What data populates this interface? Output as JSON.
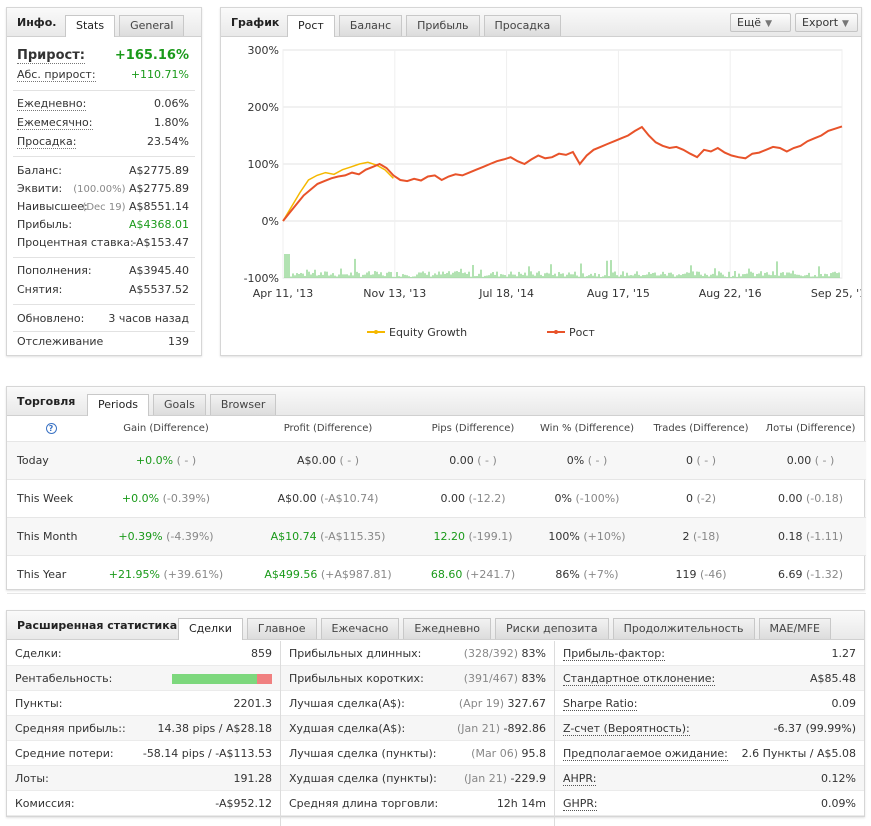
{
  "info_panel": {
    "title": "Инфо.",
    "tabs": [
      "Stats",
      "General"
    ],
    "gain": {
      "label": "Прирост:",
      "value": "+165.16%"
    },
    "abs_gain": {
      "label": "Абс. прирост:",
      "value": "+110.71%"
    },
    "daily": {
      "label": "Ежедневно:",
      "value": "0.06%"
    },
    "monthly": {
      "label": "Ежемесячно:",
      "value": "1.80%"
    },
    "drawdown": {
      "label": "Просадка:",
      "value": "23.54%"
    },
    "balance": {
      "label": "Баланс:",
      "value": "A$2775.89"
    },
    "equity": {
      "label": "Эквити:",
      "note": "(100.00%)",
      "value": "A$2775.89"
    },
    "highest": {
      "label": "Наивысшее:",
      "note": "(Dec 19)",
      "value": "A$8551.14"
    },
    "profit": {
      "label": "Прибыль:",
      "value": "A$4368.01"
    },
    "interest": {
      "label": "Процентная ставка:",
      "value": "-A$153.47"
    },
    "deposits": {
      "label": "Пополнения:",
      "value": "A$3945.40"
    },
    "withdrawals": {
      "label": "Снятия:",
      "value": "A$5537.52"
    },
    "updated": {
      "label": "Обновлено:",
      "value": "3 часов назад"
    },
    "tracking": {
      "label": "Отслеживание",
      "value": "139"
    }
  },
  "chart_panel": {
    "title": "График",
    "tabs": [
      "Рост",
      "Баланс",
      "Прибыль",
      "Просадка"
    ],
    "more_button": "Ещё",
    "export_button": "Export"
  },
  "chart_data": {
    "type": "line",
    "x_tick_labels": [
      "Apr 11, '13",
      "Nov 13, '13",
      "Jul 18, '14",
      "Aug 17, '15",
      "Aug 22, '16",
      "Sep 25, '17"
    ],
    "y_tick_labels": [
      "300%",
      "200%",
      "100%",
      "0%",
      "-100%"
    ],
    "ylim": [
      -100,
      300
    ],
    "grid": true,
    "legend_position": "bottom",
    "series": [
      {
        "name": "Equity Growth",
        "color": "#f5b800",
        "values": [
          0,
          25,
          50,
          72,
          80,
          85,
          82,
          90,
          95,
          100,
          103,
          98,
          90,
          75
        ]
      },
      {
        "name": "Рост",
        "color": "#e8532a",
        "values": [
          0,
          15,
          30,
          45,
          55,
          65,
          70,
          75,
          78,
          80,
          85,
          82,
          90,
          95,
          100,
          93,
          80,
          72,
          70,
          74,
          71,
          78,
          80,
          72,
          78,
          82,
          80,
          85,
          90,
          95,
          100,
          105,
          108,
          112,
          105,
          100,
          108,
          115,
          110,
          112,
          118,
          116,
          121,
          100,
          115,
          125,
          130,
          135,
          140,
          145,
          150,
          158,
          165,
          150,
          138,
          132,
          128,
          130,
          125,
          118,
          112,
          125,
          122,
          128,
          120,
          115,
          112,
          110,
          118,
          120,
          125,
          130,
          128,
          122,
          128,
          132,
          140,
          145,
          150,
          158,
          162,
          166
        ]
      }
    ],
    "volume_color": "#7fcf7f"
  },
  "trading_panel": {
    "title": "Торговля",
    "tabs": [
      "Periods",
      "Goals",
      "Browser"
    ],
    "help_icon": "?",
    "headers": [
      "Gain (Difference)",
      "Profit (Difference)",
      "Pips (Difference)",
      "Win % (Difference)",
      "Trades (Difference)",
      "Лоты (Difference)"
    ],
    "rows": [
      {
        "period": "Today",
        "gain": "+0.0%",
        "gain_d": "( - )",
        "profit": "A$0.00",
        "profit_d": "( - )",
        "pips": "0.00",
        "pips_d": "( - )",
        "win": "0%",
        "win_d": "( - )",
        "trades": "0",
        "trades_d": "( - )",
        "lots": "0.00",
        "lots_d": "( - )"
      },
      {
        "period": "This Week",
        "gain": "+0.0%",
        "gain_d": "(-0.39%)",
        "profit": "A$0.00",
        "profit_d": "(-A$10.74)",
        "pips": "0.00",
        "pips_d": "(-12.2)",
        "win": "0%",
        "win_d": "(-100%)",
        "trades": "0",
        "trades_d": "(-2)",
        "lots": "0.00",
        "lots_d": "(-0.18)"
      },
      {
        "period": "This Month",
        "gain": "+0.39%",
        "gain_d": "(-4.39%)",
        "profit": "A$10.74",
        "profit_d": "(-A$115.35)",
        "pips": "12.20",
        "pips_d": "(-199.1)",
        "win": "100%",
        "win_d": "(+10%)",
        "trades": "2",
        "trades_d": "(-18)",
        "lots": "0.18",
        "lots_d": "(-1.11)"
      },
      {
        "period": "This Year",
        "gain": "+21.95%",
        "gain_d": "(+39.61%)",
        "profit": "A$499.56",
        "profit_d": "(+A$987.81)",
        "pips": "68.60",
        "pips_d": "(+241.7)",
        "win": "86%",
        "win_d": "(+7%)",
        "trades": "119",
        "trades_d": "(-46)",
        "lots": "6.69",
        "lots_d": "(-1.32)"
      }
    ]
  },
  "advanced_panel": {
    "title": "Расширенная статистика",
    "tabs": [
      "Сделки",
      "Главное",
      "Ежечасно",
      "Ежедневно",
      "Риски депозита",
      "Продолжительность",
      "MAE/MFE"
    ],
    "profitability_fraction": 0.85,
    "col1": [
      {
        "label": "Сделки:",
        "value": "859"
      },
      {
        "label": "Рентабельность:",
        "value": ""
      },
      {
        "label": "Пункты:",
        "value": "2201.3"
      },
      {
        "label": "Средняя прибыль::",
        "value": "14.38 pips / A$28.18"
      },
      {
        "label": "Средние потери:",
        "value": "-58.14 pips / -A$113.53"
      },
      {
        "label": "Лоты:",
        "value": "191.28"
      },
      {
        "label": "Комиссия:",
        "value": "-A$952.12"
      }
    ],
    "col2": [
      {
        "label": "Прибыльных длинных:",
        "note": "(328/392)",
        "value": "83%"
      },
      {
        "label": "Прибыльных коротких:",
        "note": "(391/467)",
        "value": "83%"
      },
      {
        "label": "Лучшая сделка(A$):",
        "note": "(Apr 19)",
        "value": "327.67"
      },
      {
        "label": "Худшая сделка(A$):",
        "note": "(Jan 21)",
        "value": "-892.86"
      },
      {
        "label": "Лучшая сделка (пункты):",
        "note": "(Mar 06)",
        "value": "95.8"
      },
      {
        "label": "Худшая сделка (пункты):",
        "note": "(Jan 21)",
        "value": "-229.9"
      },
      {
        "label": "Средняя длина торговли:",
        "note": "",
        "value": "12h 14m"
      }
    ],
    "col3": [
      {
        "label": "Прибыль-фактор:",
        "value": "1.27"
      },
      {
        "label": "Стандартное отклонение:",
        "value": "A$85.48"
      },
      {
        "label": "Sharpe Ratio:",
        "value": "0.09"
      },
      {
        "label": "Z-счет (Вероятность):",
        "value": "-6.37 (99.99%)"
      },
      {
        "label": "Предполагаемое ожидание:",
        "value": "2.6 Пункты / A$5.08"
      },
      {
        "label": "AHPR:",
        "value": "0.12%"
      },
      {
        "label": "GHPR:",
        "value": "0.09%"
      }
    ]
  }
}
